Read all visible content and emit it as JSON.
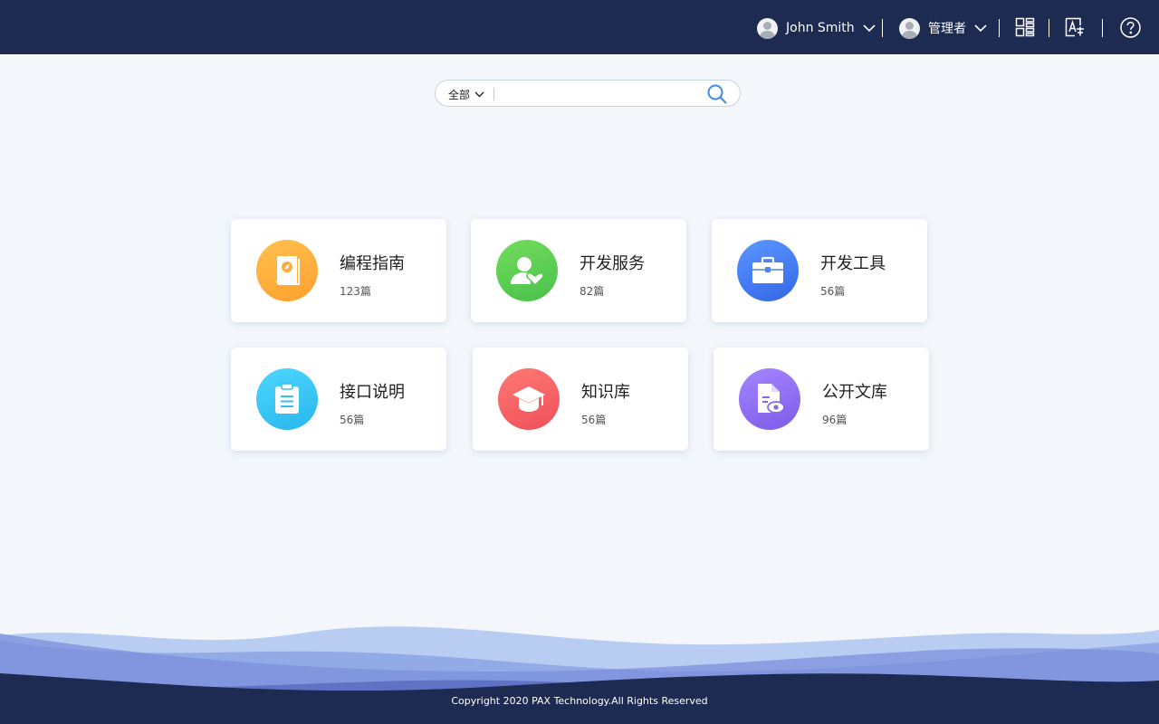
{
  "header": {
    "user_name": "John Smith",
    "role_name": "管理者"
  },
  "icons": {
    "apps": "grid-apps-icon",
    "translate": "language-translate-icon",
    "help": "help-circle-icon",
    "search": "search-icon"
  },
  "search": {
    "scope_label": "全部",
    "value": "",
    "placeholder": ""
  },
  "cards": [
    {
      "title": "编程指南",
      "count": "123篇",
      "icon": "guide-book-icon",
      "color": "#ffad3b"
    },
    {
      "title": "开发服务",
      "count": "82篇",
      "icon": "user-heart-icon",
      "color": "#5ccf56"
    },
    {
      "title": "开发工具",
      "count": "56篇",
      "icon": "toolbox-icon",
      "color": "#3f7af2"
    },
    {
      "title": "接口说明",
      "count": "56篇",
      "icon": "clipboard-icon",
      "color": "#33c7f0"
    },
    {
      "title": "知识库",
      "count": "56篇",
      "icon": "graduation-cap-icon",
      "color": "#f26266"
    },
    {
      "title": "公开文库",
      "count": "96篇",
      "icon": "document-view-icon",
      "color": "#8b6cf0"
    }
  ],
  "footer": {
    "copyright": "Copyright 2020 PAX Technology.All Rights Reserved"
  },
  "colors": {
    "topbar": "#1d2a52",
    "background": "#f3f7fb",
    "accent": "#3c8de0"
  }
}
